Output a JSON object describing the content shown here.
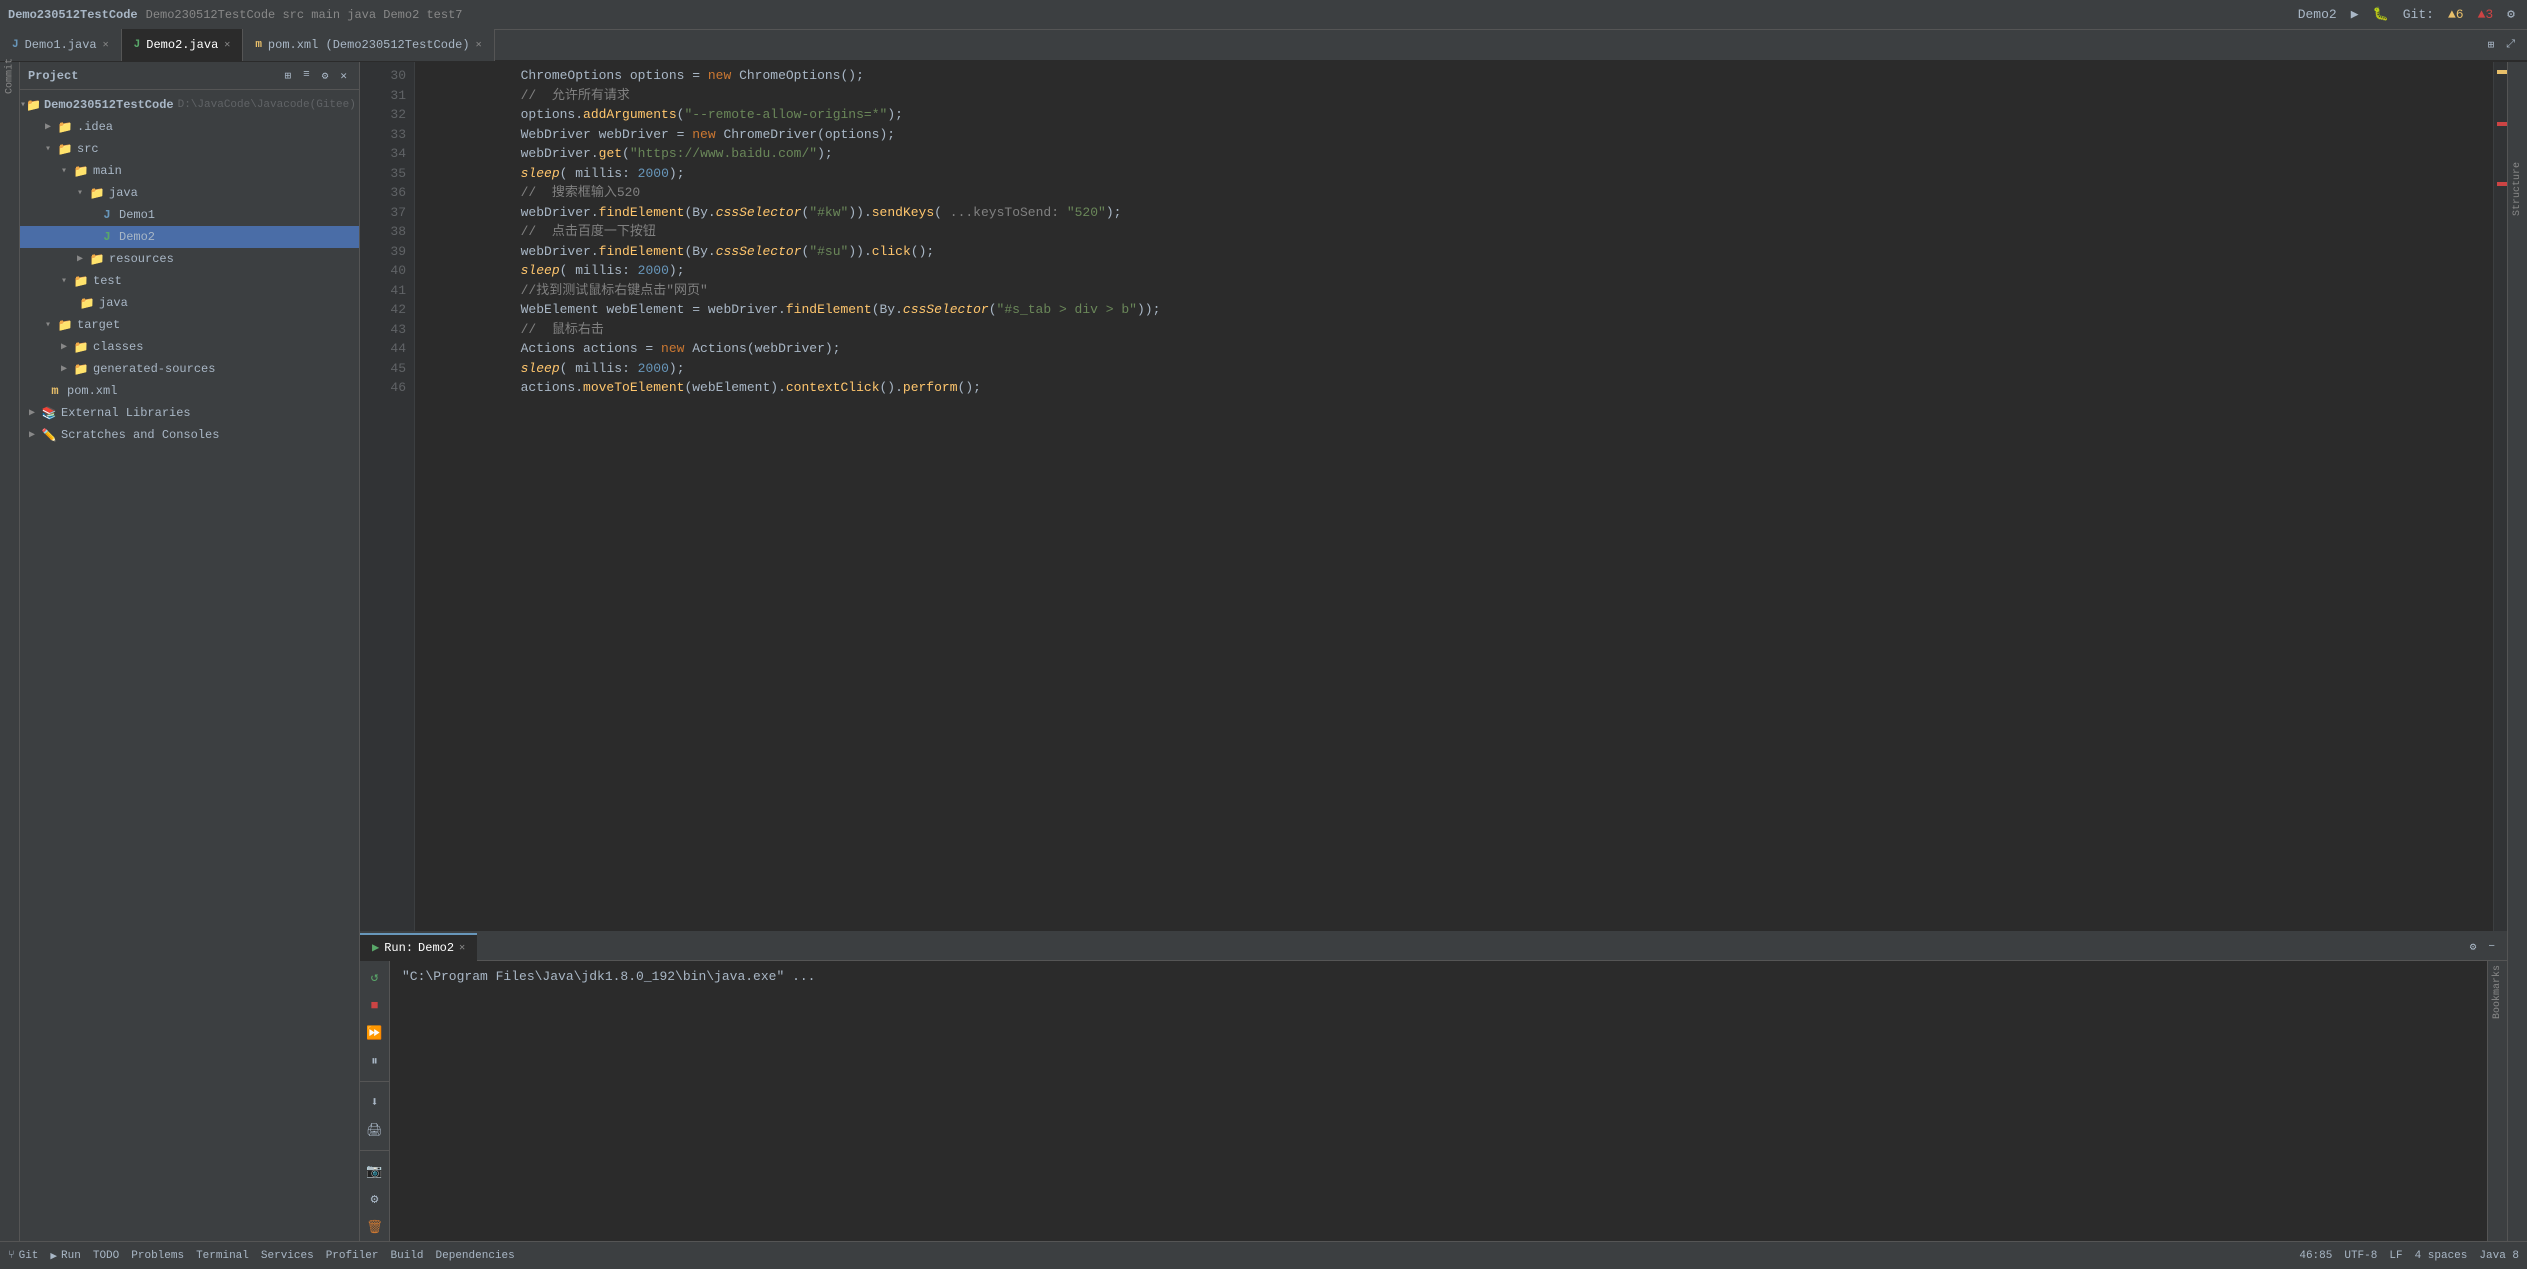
{
  "window": {
    "title": "Demo230512TestCode"
  },
  "topbar": {
    "breadcrumb": "Demo230512TestCode  src  main  java  Demo2  test7",
    "project_label": "Project",
    "run_config": "Demo2",
    "git_label": "Git:",
    "warnings": "▲6",
    "errors": "▲3"
  },
  "tabs": [
    {
      "id": "demo1",
      "label": "Demo1.java",
      "icon": "J",
      "active": false,
      "modified": false
    },
    {
      "id": "demo2",
      "label": "Demo2.java",
      "icon": "J",
      "active": true,
      "modified": false
    },
    {
      "id": "pom",
      "label": "pom.xml (Demo230512TestCode)",
      "icon": "m",
      "active": false,
      "modified": false
    }
  ],
  "sidebar": {
    "header": "Project",
    "tree": [
      {
        "id": "root",
        "label": "Demo230512TestCode",
        "sublabel": "D:\\JavaCode\\Javacode(Gitee)",
        "indent": 0,
        "arrow": "▾",
        "icon": "📁",
        "expanded": true
      },
      {
        "id": "idea",
        "label": ".idea",
        "indent": 1,
        "arrow": "▶",
        "icon": "📁",
        "expanded": false
      },
      {
        "id": "src",
        "label": "src",
        "indent": 1,
        "arrow": "▾",
        "icon": "📁",
        "expanded": true
      },
      {
        "id": "main",
        "label": "main",
        "indent": 2,
        "arrow": "▾",
        "icon": "📁",
        "expanded": true
      },
      {
        "id": "java",
        "label": "java",
        "indent": 3,
        "arrow": "▾",
        "icon": "📁",
        "expanded": true
      },
      {
        "id": "demo1",
        "label": "Demo1",
        "indent": 4,
        "arrow": "",
        "icon": "J",
        "type": "java"
      },
      {
        "id": "demo2",
        "label": "Demo2",
        "indent": 4,
        "arrow": "",
        "icon": "J",
        "type": "java-run",
        "selected": true
      },
      {
        "id": "resources",
        "label": "resources",
        "indent": 3,
        "arrow": "▶",
        "icon": "📁",
        "expanded": false
      },
      {
        "id": "test",
        "label": "test",
        "indent": 2,
        "arrow": "▾",
        "icon": "📁",
        "expanded": true
      },
      {
        "id": "test-java",
        "label": "java",
        "indent": 3,
        "arrow": "",
        "icon": "📁"
      },
      {
        "id": "target",
        "label": "target",
        "indent": 1,
        "arrow": "▾",
        "icon": "📁",
        "expanded": true
      },
      {
        "id": "classes",
        "label": "classes",
        "indent": 2,
        "arrow": "▶",
        "icon": "📁"
      },
      {
        "id": "generated",
        "label": "generated-sources",
        "indent": 2,
        "arrow": "▶",
        "icon": "📁"
      },
      {
        "id": "pom",
        "label": "pom.xml",
        "indent": 1,
        "arrow": "",
        "icon": "m",
        "type": "xml"
      },
      {
        "id": "ext-libs",
        "label": "External Libraries",
        "indent": 0,
        "arrow": "▶",
        "icon": "📚"
      },
      {
        "id": "scratches",
        "label": "Scratches and Consoles",
        "indent": 0,
        "arrow": "▶",
        "icon": "✏️"
      }
    ]
  },
  "code": {
    "lines": [
      {
        "num": 30,
        "content": "            ChromeOptions options = new ChromeOptions();",
        "tokens": [
          {
            "text": "            ChromeOptions options = ",
            "cls": "var"
          },
          {
            "text": "new",
            "cls": "kw"
          },
          {
            "text": " ChromeOptions();",
            "cls": "var"
          }
        ]
      },
      {
        "num": 31,
        "content": "            //  允许所有请求",
        "cls": "cm"
      },
      {
        "num": 32,
        "content": "            options.addArguments(\"--remote-allow-origins=*\");",
        "tokens": [
          {
            "text": "            options.",
            "cls": "var"
          },
          {
            "text": "addArguments",
            "cls": "fn"
          },
          {
            "text": "(",
            "cls": "op"
          },
          {
            "text": "\"--remote-allow-origins=*\"",
            "cls": "str"
          },
          {
            "text": ");",
            "cls": "op"
          }
        ]
      },
      {
        "num": 33,
        "content": "            WebDriver webDriver = new ChromeDriver(options);",
        "tokens": [
          {
            "text": "            WebDriver webDriver = ",
            "cls": "var"
          },
          {
            "text": "new",
            "cls": "kw"
          },
          {
            "text": " ChromeDriver(options);",
            "cls": "var"
          }
        ]
      },
      {
        "num": 34,
        "content": "            webDriver.get(\"https://www.baidu.com/\");",
        "tokens": [
          {
            "text": "            webDriver.",
            "cls": "var"
          },
          {
            "text": "get",
            "cls": "fn"
          },
          {
            "text": "(",
            "cls": "op"
          },
          {
            "text": "\"https://www.baidu.com/\"",
            "cls": "str"
          },
          {
            "text": ");",
            "cls": "op"
          }
        ]
      },
      {
        "num": 35,
        "content": "            sleep( millis: 2000);",
        "tokens": [
          {
            "text": "            ",
            "cls": "var"
          },
          {
            "text": "sleep",
            "cls": "fn it"
          },
          {
            "text": "( ",
            "cls": "op"
          },
          {
            "text": "millis",
            "cls": "param"
          },
          {
            "text": ": ",
            "cls": "op"
          },
          {
            "text": "2000",
            "cls": "num"
          },
          {
            "text": ");",
            "cls": "op"
          }
        ]
      },
      {
        "num": 36,
        "content": "            //  搜索框输入520",
        "cls": "cm"
      },
      {
        "num": 37,
        "content": "            webDriver.findElement(By.cssSelector(\"#kw\")).sendKeys( ...keysToSend: \"520\");",
        "tokens": [
          {
            "text": "            webDriver.",
            "cls": "var"
          },
          {
            "text": "findElement",
            "cls": "fn"
          },
          {
            "text": "(By.",
            "cls": "op"
          },
          {
            "text": "cssSelector",
            "cls": "fn it"
          },
          {
            "text": "(",
            "cls": "op"
          },
          {
            "text": "\"#kw\"",
            "cls": "str"
          },
          {
            "text": ")).",
            "cls": "op"
          },
          {
            "text": "sendKeys",
            "cls": "fn"
          },
          {
            "text": "( ",
            "cls": "op"
          },
          {
            "text": "...keysToSend: ",
            "cls": "cm"
          },
          {
            "text": "\"520\"",
            "cls": "str"
          },
          {
            "text": ");",
            "cls": "op"
          }
        ]
      },
      {
        "num": 38,
        "content": "            //  点击百度一下按钮",
        "cls": "cm"
      },
      {
        "num": 39,
        "content": "            webDriver.findElement(By.cssSelector(\"#su\")).click();",
        "tokens": [
          {
            "text": "            webDriver.",
            "cls": "var"
          },
          {
            "text": "findElement",
            "cls": "fn"
          },
          {
            "text": "(By.",
            "cls": "op"
          },
          {
            "text": "cssSelector",
            "cls": "fn it"
          },
          {
            "text": "(",
            "cls": "op"
          },
          {
            "text": "\"#su\"",
            "cls": "str"
          },
          {
            "text": ")).",
            "cls": "op"
          },
          {
            "text": "click",
            "cls": "fn"
          },
          {
            "text": "();",
            "cls": "op"
          }
        ]
      },
      {
        "num": 40,
        "content": "            sleep( millis: 2000);",
        "tokens": [
          {
            "text": "            ",
            "cls": "var"
          },
          {
            "text": "sleep",
            "cls": "fn it"
          },
          {
            "text": "( ",
            "cls": "op"
          },
          {
            "text": "millis",
            "cls": "param"
          },
          {
            "text": ": ",
            "cls": "op"
          },
          {
            "text": "2000",
            "cls": "num"
          },
          {
            "text": ");",
            "cls": "op"
          }
        ]
      },
      {
        "num": 41,
        "content": "            //找到测试鼠标右键点击\"网页\"",
        "cls": "cm"
      },
      {
        "num": 42,
        "content": "            WebElement webElement = webDriver.findElement(By.cssSelector(\"#s_tab > div > b\"));",
        "tokens": [
          {
            "text": "            WebElement webElement = webDriver.",
            "cls": "var"
          },
          {
            "text": "findElement",
            "cls": "fn"
          },
          {
            "text": "(By.",
            "cls": "op"
          },
          {
            "text": "cssSelector",
            "cls": "fn it"
          },
          {
            "text": "(",
            "cls": "op"
          },
          {
            "text": "\"#s_tab > div > b\"",
            "cls": "str"
          },
          {
            "text": "));",
            "cls": "op"
          }
        ]
      },
      {
        "num": 43,
        "content": "            //  鼠标右击",
        "cls": "cm"
      },
      {
        "num": 44,
        "content": "            Actions actions = new Actions(webDriver);",
        "tokens": [
          {
            "text": "            Actions actions = ",
            "cls": "var"
          },
          {
            "text": "new",
            "cls": "kw"
          },
          {
            "text": " Actions(webDriver);",
            "cls": "var"
          }
        ]
      },
      {
        "num": 45,
        "content": "            sleep( millis: 2000);",
        "tokens": [
          {
            "text": "            ",
            "cls": "var"
          },
          {
            "text": "sleep",
            "cls": "fn it"
          },
          {
            "text": "( ",
            "cls": "op"
          },
          {
            "text": "millis",
            "cls": "param"
          },
          {
            "text": ": ",
            "cls": "op"
          },
          {
            "text": "2000",
            "cls": "num"
          },
          {
            "text": ");",
            "cls": "op"
          }
        ]
      },
      {
        "num": 46,
        "content": "            actions.moveToElement(webElement).contextClick().perform();",
        "tokens": [
          {
            "text": "            actions.",
            "cls": "var"
          },
          {
            "text": "moveToElement",
            "cls": "fn"
          },
          {
            "text": "(webElement).",
            "cls": "var"
          },
          {
            "text": "contextClick",
            "cls": "fn"
          },
          {
            "text": "().",
            "cls": "op"
          },
          {
            "text": "perform",
            "cls": "fn"
          },
          {
            "text": "();",
            "cls": "op"
          }
        ]
      }
    ]
  },
  "bottom_panel": {
    "tabs": [
      {
        "id": "run",
        "label": "Run:",
        "icon": "▶",
        "run_name": "Demo2",
        "active": true
      }
    ],
    "console_output": "\"C:\\Program Files\\Java\\jdk1.8.0_192\\bin\\java.exe\" ..."
  },
  "statusbar": {
    "git": "Git",
    "run": "Run",
    "todo": "TODO",
    "problems": "Problems",
    "terminal": "Terminal",
    "services": "Services",
    "profiler": "Profiler",
    "build": "Build",
    "dependencies": "Dependencies"
  }
}
